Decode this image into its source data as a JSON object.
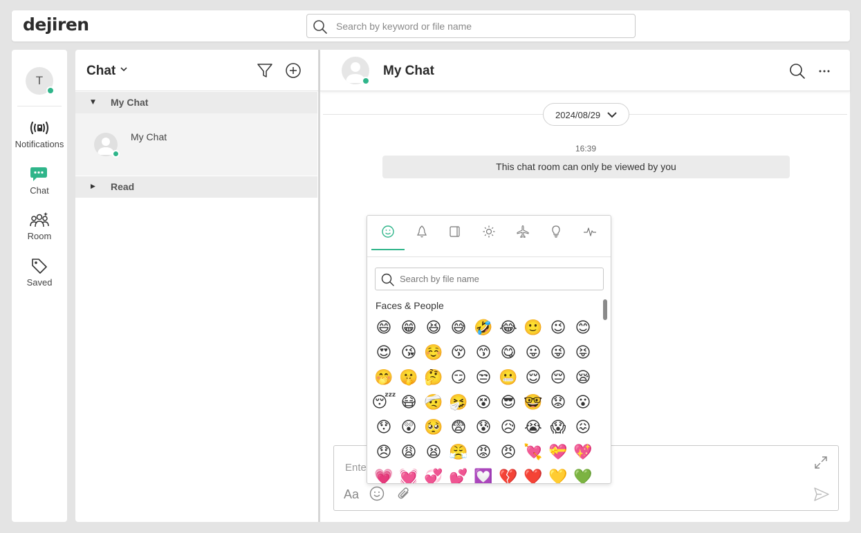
{
  "app": {
    "logo_text": "dejiren"
  },
  "top_search": {
    "placeholder": "Search by keyword or file name"
  },
  "user": {
    "initial": "T"
  },
  "nav": {
    "items": [
      {
        "label": "Notifications",
        "icon": "broadcast-icon"
      },
      {
        "label": "Chat",
        "icon": "chat-icon"
      },
      {
        "label": "Room",
        "icon": "people-icon"
      },
      {
        "label": "Saved",
        "icon": "tag-icon"
      }
    ]
  },
  "list": {
    "title": "Chat",
    "groups": [
      {
        "label": "My Chat",
        "expanded": true
      },
      {
        "label": "Read",
        "expanded": false
      }
    ],
    "items": [
      {
        "name": "My Chat"
      }
    ]
  },
  "chat": {
    "title": "My Chat",
    "date": "2024/08/29",
    "time": "16:39",
    "system_message": "This chat room can only be viewed by you",
    "composer_placeholder": "Ente",
    "font_button": "Aa"
  },
  "emoji_picker": {
    "search_placeholder": "Search by file name",
    "section_title": "Faces & People",
    "tabs": [
      "smiley-icon",
      "bell-icon",
      "object-icon",
      "sun-icon",
      "plane-icon",
      "bulb-icon",
      "activity-icon"
    ],
    "emojis": [
      [
        "😄",
        "😁",
        "😆",
        "😅",
        "🤣",
        "😂",
        "🙂",
        "😉",
        "😊"
      ],
      [
        "😍",
        "😘",
        "☺️",
        "😚",
        "😙",
        "😋",
        "😛",
        "😜",
        "😝"
      ],
      [
        "🤭",
        "🤫",
        "🤔",
        "😏",
        "😒",
        "😬",
        "😌",
        "😔",
        "😪"
      ],
      [
        "😴",
        "😷",
        "🤕",
        "🤧",
        "😵",
        "😎",
        "🤓",
        "😟",
        "😮"
      ],
      [
        "😯",
        "😲",
        "🥺",
        "😨",
        "😰",
        "😥",
        "😭",
        "😱",
        "😖"
      ],
      [
        "😞",
        "😩",
        "😫",
        "😤",
        "😡",
        "😠",
        "💘",
        "💝",
        "💖"
      ],
      [
        "💗",
        "💓",
        "💞",
        "💕",
        "💟",
        "💔",
        "❤️",
        "💛",
        "💚"
      ]
    ]
  },
  "colors": {
    "accent": "#2fb58a",
    "background": "#e4e4e4"
  }
}
